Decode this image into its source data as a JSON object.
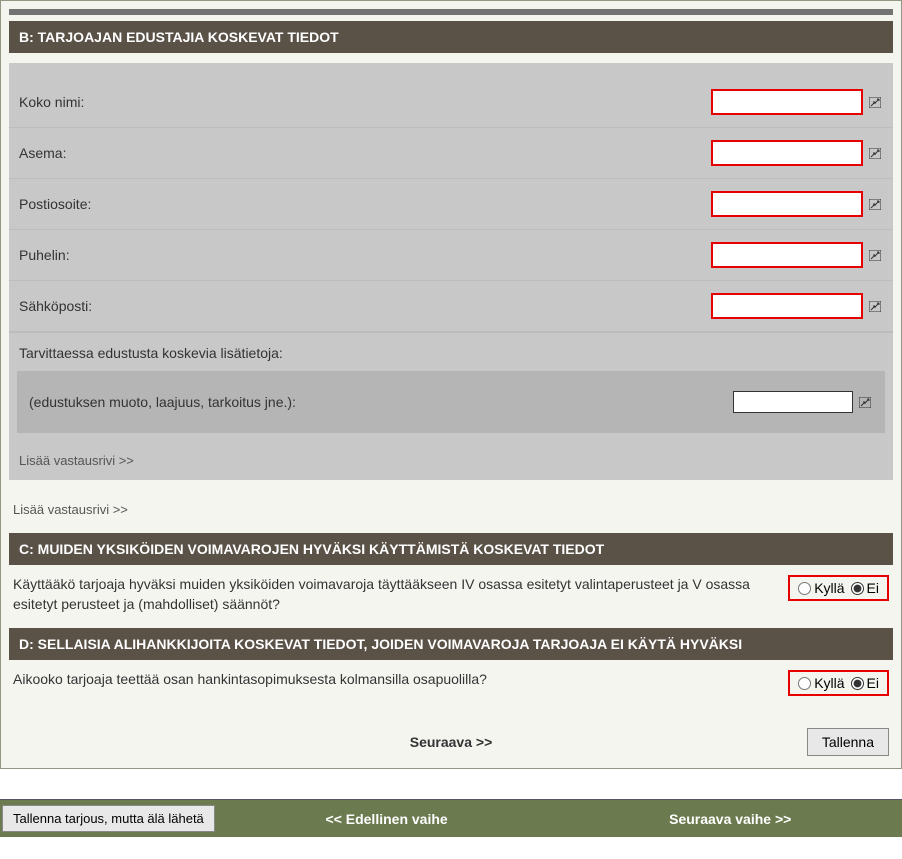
{
  "sections": {
    "b": {
      "title": "B: TARJOAJAN EDUSTAJIA KOSKEVAT TIEDOT",
      "fields": {
        "name": "Koko nimi:",
        "position": "Asema:",
        "postal": "Postiosoite:",
        "phone": "Puhelin:",
        "email": "Sähköposti:"
      },
      "subhead": "Tarvittaessa edustusta koskevia lisätietoja:",
      "detail_label": "(edustuksen muoto, laajuus, tarkoitus jne.):",
      "add_row_inner": "Lisää vastausrivi >>",
      "add_row_outer": "Lisää vastausrivi >>"
    },
    "c": {
      "title": "C: MUIDEN YKSIKÖIDEN VOIMAVAROJEN HYVÄKSI KÄYTTÄMISTÄ KOSKEVAT TIEDOT",
      "question": "Käyttääkö tarjoaja hyväksi muiden yksiköiden voimavaroja täyttääkseen IV osassa esitetyt valintaperusteet ja V osassa esitetyt perusteet ja (mahdolliset) säännöt?"
    },
    "d": {
      "title": "D: SELLAISIA ALIHANKKIJOITA KOSKEVAT TIEDOT, JOIDEN VOIMAVAROJA TARJOAJA EI KÄYTÄ HYVÄKSI",
      "question": "Aikooko tarjoaja teettää osan hankintasopimuksesta kolmansilla osapuolilla?"
    }
  },
  "radio": {
    "yes": "Kyllä",
    "no": "Ei"
  },
  "nav": {
    "next": "Seuraava >>",
    "save": "Tallenna",
    "save_no_send": "Tallenna tarjous, mutta älä lähetä",
    "prev_step": "<< Edellinen vaihe",
    "next_step": "Seuraava vaihe >>"
  }
}
